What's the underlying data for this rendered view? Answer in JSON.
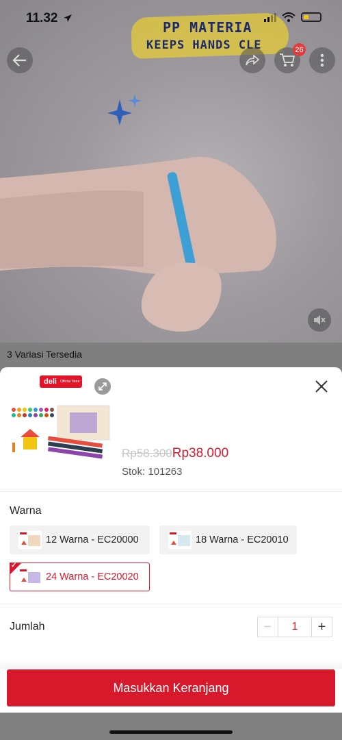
{
  "status_bar": {
    "time": "11.32"
  },
  "video": {
    "banner_line1": "PP MATERIA",
    "banner_line2": "KEEPS HANDS CLE",
    "cart_count": "26"
  },
  "variants_available": "3 Variasi Tersedia",
  "sheet": {
    "brand_badge": "deli",
    "brand_sub": "Official Store",
    "old_price": "Rp58.300",
    "price": "Rp38.000",
    "stock": "Stok: 101263",
    "color_label": "Warna",
    "options": [
      {
        "label": "12 Warna - EC20000",
        "selected": false
      },
      {
        "label": "18 Warna - EC20010",
        "selected": false
      },
      {
        "label": "24 Warna - EC20020",
        "selected": true
      }
    ],
    "quantity_label": "Jumlah",
    "quantity": "1",
    "minus": "−",
    "plus": "+",
    "cta": "Masukkan Keranjang"
  },
  "colors": {
    "accent": "#d8182c",
    "brand": "#e0152a"
  }
}
